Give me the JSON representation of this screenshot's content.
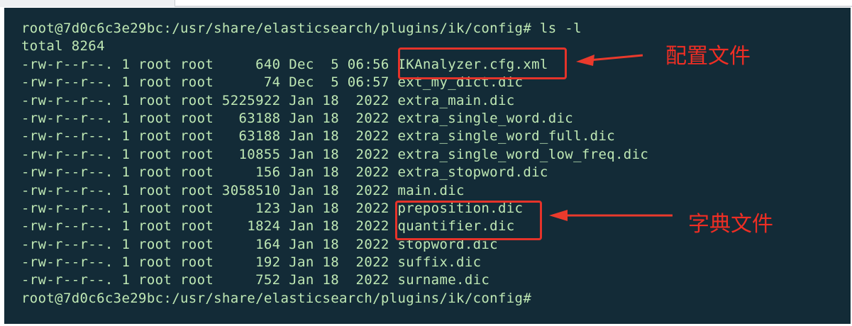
{
  "terminal": {
    "lines": [
      "root@7d0c6c3e29bc:/usr/share/elasticsearch/plugins/ik/config# ls -l",
      "total 8264",
      "-rw-r--r--. 1 root root     640 Dec  5 06:56 IKAnalyzer.cfg.xml",
      "-rw-r--r--. 1 root root      74 Dec  5 06:57 ext_my_dict.dic",
      "-rw-r--r--. 1 root root 5225922 Jan 18  2022 extra_main.dic",
      "-rw-r--r--. 1 root root   63188 Jan 18  2022 extra_single_word.dic",
      "-rw-r--r--. 1 root root   63188 Jan 18  2022 extra_single_word_full.dic",
      "-rw-r--r--. 1 root root   10855 Jan 18  2022 extra_single_word_low_freq.dic",
      "-rw-r--r--. 1 root root     156 Jan 18  2022 extra_stopword.dic",
      "-rw-r--r--. 1 root root 3058510 Jan 18  2022 main.dic",
      "-rw-r--r--. 1 root root     123 Jan 18  2022 preposition.dic",
      "-rw-r--r--. 1 root root    1824 Jan 18  2022 quantifier.dic",
      "-rw-r--r--. 1 root root     164 Jan 18  2022 stopword.dic",
      "-rw-r--r--. 1 root root     192 Jan 18  2022 suffix.dic",
      "-rw-r--r--. 1 root root     752 Jan 18  2022 surname.dic",
      "root@7d0c6c3e29bc:/usr/share/elasticsearch/plugins/ik/config#"
    ]
  },
  "annotations": {
    "config_label": "配置文件",
    "dict_label": "字典文件"
  },
  "colors": {
    "terminal_bg": "#132b37",
    "terminal_text": "#bfe8b4",
    "annotation_red": "#e5332a"
  }
}
